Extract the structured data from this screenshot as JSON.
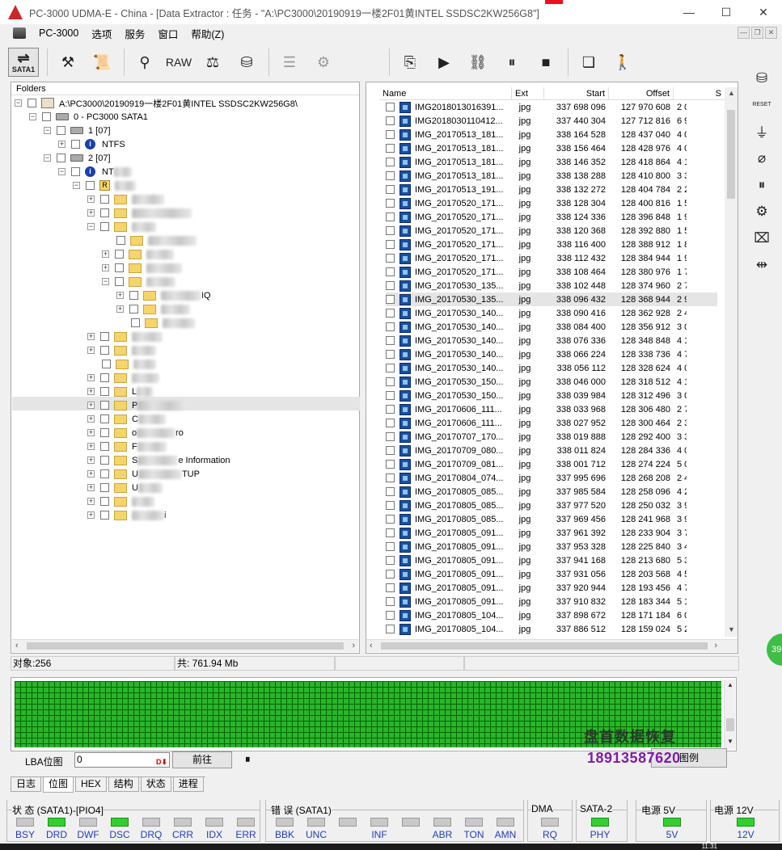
{
  "window": {
    "title": "PC-3000 UDMA-E - China - [Data Extractor : 任务 - \"A:\\PC3000\\20190919一楼2F01黄INTEL SSDSC2KW256G8\"]",
    "minimize": "—",
    "maximize": "☐",
    "close": "✕"
  },
  "menu": {
    "items": [
      "PC-3000",
      "选项",
      "服务",
      "窗口",
      "帮助(Z)"
    ]
  },
  "toolbar": {
    "sata_label": "SATA1",
    "raw_label": "RAW"
  },
  "folders": {
    "header": "Folders",
    "root": "A:\\PC3000\\20190919一楼2F01黄INTEL SSDSC2KW256G8\\",
    "device": "0 - PC3000 SATA1",
    "part1": "1 [07]",
    "fs1": "NTFS",
    "part2": "2 [07]",
    "fs2": "NT",
    "r_label": "R",
    "items": [
      "IQ",
      "L",
      "P",
      "C",
      "o",
      "ro",
      "F",
      "S",
      "e Information",
      "U",
      "TUP",
      "U",
      "i"
    ]
  },
  "files": {
    "columns": [
      "Name",
      "Ext",
      "Start",
      "Offset",
      "S"
    ],
    "rows": [
      {
        "name": "IMG2018013016391...",
        "ext": "jpg",
        "start": "337 698 096",
        "offset": "127 970 608",
        "size": "2 0"
      },
      {
        "name": "IMG2018030110412...",
        "ext": "jpg",
        "start": "337 440 304",
        "offset": "127 712 816",
        "size": "6 9"
      },
      {
        "name": "IMG_20170513_181...",
        "ext": "jpg",
        "start": "338 164 528",
        "offset": "128 437 040",
        "size": "4 0"
      },
      {
        "name": "IMG_20170513_181...",
        "ext": "jpg",
        "start": "338 156 464",
        "offset": "128 428 976",
        "size": "4 0"
      },
      {
        "name": "IMG_20170513_181...",
        "ext": "jpg",
        "start": "338 146 352",
        "offset": "128 418 864",
        "size": "4 1"
      },
      {
        "name": "IMG_20170513_181...",
        "ext": "jpg",
        "start": "338 138 288",
        "offset": "128 410 800",
        "size": "3 3"
      },
      {
        "name": "IMG_20170513_191...",
        "ext": "jpg",
        "start": "338 132 272",
        "offset": "128 404 784",
        "size": "2 2"
      },
      {
        "name": "IMG_20170520_171...",
        "ext": "jpg",
        "start": "338 128 304",
        "offset": "128 400 816",
        "size": "1 5"
      },
      {
        "name": "IMG_20170520_171...",
        "ext": "jpg",
        "start": "338 124 336",
        "offset": "128 396 848",
        "size": "1 9"
      },
      {
        "name": "IMG_20170520_171...",
        "ext": "jpg",
        "start": "338 120 368",
        "offset": "128 392 880",
        "size": "1 5"
      },
      {
        "name": "IMG_20170520_171...",
        "ext": "jpg",
        "start": "338 116 400",
        "offset": "128 388 912",
        "size": "1 8"
      },
      {
        "name": "IMG_20170520_171...",
        "ext": "jpg",
        "start": "338 112 432",
        "offset": "128 384 944",
        "size": "1 9"
      },
      {
        "name": "IMG_20170520_171...",
        "ext": "jpg",
        "start": "338 108 464",
        "offset": "128 380 976",
        "size": "1 7"
      },
      {
        "name": "IMG_20170530_135...",
        "ext": "jpg",
        "start": "338 102 448",
        "offset": "128 374 960",
        "size": "2 7"
      },
      {
        "name": "IMG_20170530_135...",
        "ext": "jpg",
        "start": "338 096 432",
        "offset": "128 368 944",
        "size": "2 9"
      },
      {
        "name": "IMG_20170530_140...",
        "ext": "jpg",
        "start": "338 090 416",
        "offset": "128 362 928",
        "size": "2 4"
      },
      {
        "name": "IMG_20170530_140...",
        "ext": "jpg",
        "start": "338 084 400",
        "offset": "128 356 912",
        "size": "3 0"
      },
      {
        "name": "IMG_20170530_140...",
        "ext": "jpg",
        "start": "338 076 336",
        "offset": "128 348 848",
        "size": "4 1"
      },
      {
        "name": "IMG_20170530_140...",
        "ext": "jpg",
        "start": "338 066 224",
        "offset": "128 338 736",
        "size": "4 7"
      },
      {
        "name": "IMG_20170530_140...",
        "ext": "jpg",
        "start": "338 056 112",
        "offset": "128 328 624",
        "size": "4 0"
      },
      {
        "name": "IMG_20170530_150...",
        "ext": "jpg",
        "start": "338 046 000",
        "offset": "128 318 512",
        "size": "4 1"
      },
      {
        "name": "IMG_20170530_150...",
        "ext": "jpg",
        "start": "338 039 984",
        "offset": "128 312 496",
        "size": "3 0"
      },
      {
        "name": "IMG_20170606_111...",
        "ext": "jpg",
        "start": "338 033 968",
        "offset": "128 306 480",
        "size": "2 7"
      },
      {
        "name": "IMG_20170606_111...",
        "ext": "jpg",
        "start": "338 027 952",
        "offset": "128 300 464",
        "size": "2 3"
      },
      {
        "name": "IMG_20170707_170...",
        "ext": "jpg",
        "start": "338 019 888",
        "offset": "128 292 400",
        "size": "3 3"
      },
      {
        "name": "IMG_20170709_080...",
        "ext": "jpg",
        "start": "338 011 824",
        "offset": "128 284 336",
        "size": "4 0"
      },
      {
        "name": "IMG_20170709_081...",
        "ext": "jpg",
        "start": "338 001 712",
        "offset": "128 274 224",
        "size": "5 0"
      },
      {
        "name": "IMG_20170804_074...",
        "ext": "jpg",
        "start": "337 995 696",
        "offset": "128 268 208",
        "size": "2 4"
      },
      {
        "name": "IMG_20170805_085...",
        "ext": "jpg",
        "start": "337 985 584",
        "offset": "128 258 096",
        "size": "4 2"
      },
      {
        "name": "IMG_20170805_085...",
        "ext": "jpg",
        "start": "337 977 520",
        "offset": "128 250 032",
        "size": "3 9"
      },
      {
        "name": "IMG_20170805_085...",
        "ext": "jpg",
        "start": "337 969 456",
        "offset": "128 241 968",
        "size": "3 9"
      },
      {
        "name": "IMG_20170805_091...",
        "ext": "jpg",
        "start": "337 961 392",
        "offset": "128 233 904",
        "size": "3 7"
      },
      {
        "name": "IMG_20170805_091...",
        "ext": "jpg",
        "start": "337 953 328",
        "offset": "128 225 840",
        "size": "3 4"
      },
      {
        "name": "IMG_20170805_091...",
        "ext": "jpg",
        "start": "337 941 168",
        "offset": "128 213 680",
        "size": "5 3"
      },
      {
        "name": "IMG_20170805_091...",
        "ext": "jpg",
        "start": "337 931 056",
        "offset": "128 203 568",
        "size": "4 5"
      },
      {
        "name": "IMG_20170805_091...",
        "ext": "jpg",
        "start": "337 920 944",
        "offset": "128 193 456",
        "size": "4 7"
      },
      {
        "name": "IMG_20170805_091...",
        "ext": "jpg",
        "start": "337 910 832",
        "offset": "128 183 344",
        "size": "5 1"
      },
      {
        "name": "IMG_20170805_104...",
        "ext": "jpg",
        "start": "337 898 672",
        "offset": "128 171 184",
        "size": "6 0"
      },
      {
        "name": "IMG_20170805_104...",
        "ext": "jpg",
        "start": "337 886 512",
        "offset": "128 159 024",
        "size": "5 2"
      }
    ],
    "highlighted_index": 14
  },
  "status": {
    "objects": "对象:256",
    "total": "共:  761.94 Mb"
  },
  "bitmap": {
    "lba_label": "LBA位图",
    "lba_value": "0",
    "go_label": "前往",
    "pause": "⏸",
    "legend_label": "图例"
  },
  "watermark": {
    "text": "盘首数据恢复",
    "phone": "18913587620"
  },
  "tabs": [
    "日志",
    "位图",
    "HEX",
    "结构",
    "状态",
    "进程"
  ],
  "active_tab": "位图",
  "indicators": {
    "status_group": "状 态 (SATA1)-[PIO4]",
    "status_leds": [
      {
        "label": "BSY",
        "on": false
      },
      {
        "label": "DRD",
        "on": true
      },
      {
        "label": "DWF",
        "on": false
      },
      {
        "label": "DSC",
        "on": true
      },
      {
        "label": "DRQ",
        "on": false
      },
      {
        "label": "CRR",
        "on": false
      },
      {
        "label": "IDX",
        "on": false
      },
      {
        "label": "ERR",
        "on": false
      }
    ],
    "error_group": "错 误 (SATA1)",
    "error_leds": [
      {
        "label": "BBK",
        "on": false
      },
      {
        "label": "UNC",
        "on": false
      },
      {
        "label": "",
        "on": false
      },
      {
        "label": "INF",
        "on": false
      },
      {
        "label": "",
        "on": false
      },
      {
        "label": "ABR",
        "on": false
      },
      {
        "label": "TON",
        "on": false
      },
      {
        "label": "AMN",
        "on": false
      }
    ],
    "dma_group": "DMA",
    "dma_led": {
      "label": "RQ",
      "on": false
    },
    "sata2_group": "SATA-2",
    "sata2_led": {
      "label": "PHY",
      "on": true
    },
    "p5_group": "电源 5V",
    "p5_led": {
      "label": "5V",
      "on": true
    },
    "p12_group": "电源 12V",
    "p12_led": {
      "label": "12V",
      "on": true
    }
  },
  "clock": "11:31",
  "side_badge": "39",
  "colors": {
    "led_on": "#2fd12f",
    "led_label": "#1f3fb5",
    "bitmap_green": "#2ab52a",
    "phone_purple": "#7b1fa2"
  }
}
